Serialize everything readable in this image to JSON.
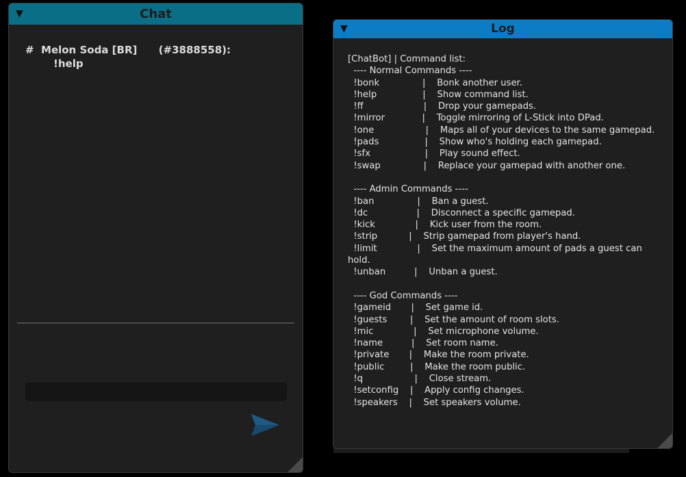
{
  "chat": {
    "title": "Chat",
    "collapse_icon": "▼",
    "messages": [
      {
        "header": "#  Melon Soda [BR]      (#3888558):",
        "text": "!help"
      }
    ],
    "input": {
      "value": "",
      "placeholder": ""
    },
    "send_icon": "send-arrow-icon",
    "accent_color": "#0a6e86"
  },
  "log": {
    "title": "Log",
    "collapse_icon": "▼",
    "accent_color": "#0b7cc5",
    "content": "[ChatBot] | Command list:\n  ---- Normal Commands ----\n  !bonk               |    Bonk another user.\n  !help                |    Show command list.\n  !ff                     |    Drop your gamepads.\n  !mirror             |    Toggle mirroring of L-Stick into DPad.\n  !one                  |    Maps all of your devices to the same gamepad.\n  !pads                |    Show who's holding each gamepad.\n  !sfx                   |    Play sound effect.\n  !swap               |    Replace your gamepad with another one.\n\n  ---- Admin Commands ----\n  !ban               |    Ban a guest.\n  !dc                 |    Disconnect a specific gamepad.\n  !kick              |    Kick user from the room.\n  !strip           |    Strip gamepad from player's hand.\n  !limit              |    Set the maximum amount of pads a guest can hold.\n  !unban          |    Unban a guest.\n\n  ---- God Commands ----\n  !gameid       |    Set game id.\n  !guests        |    Set the amount of room slots.\n  !mic              |    Set microphone volume.\n  !name          |    Set room name.\n  !private       |    Make the room private.\n  !public         |    Make the room public.\n  !q                  |    Close stream.\n  !setconfig    |    Apply config changes.\n  !speakers    |    Set speakers volume."
  }
}
